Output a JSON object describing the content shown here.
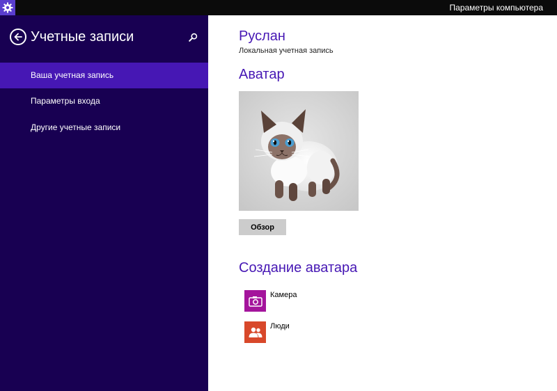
{
  "titlebar": {
    "title": "Параметры компьютера",
    "app_icon": "gear-icon"
  },
  "sidebar": {
    "title": "Учетные записи",
    "back_icon": "back-arrow-icon",
    "search_icon": "search-icon",
    "items": [
      {
        "label": "Ваша учетная запись",
        "active": true
      },
      {
        "label": "Параметры входа",
        "active": false
      },
      {
        "label": "Другие учетные записи",
        "active": false
      }
    ]
  },
  "main": {
    "user_name": "Руслан",
    "account_type": "Локальная учетная запись",
    "avatar_heading": "Аватар",
    "browse_label": "Обзор",
    "create_heading": "Создание аватара",
    "create_items": [
      {
        "label": "Камера",
        "icon": "camera-icon",
        "color": "#a4149c"
      },
      {
        "label": "Люди",
        "icon": "people-icon",
        "color": "#d8482a"
      }
    ]
  },
  "colors": {
    "sidebar_bg": "#180052",
    "accent": "#4617b4",
    "active_item_bg": "#4617b4",
    "titlebar_bg": "#0b0b0b",
    "app_icon_bg": "#5a3ecf"
  }
}
